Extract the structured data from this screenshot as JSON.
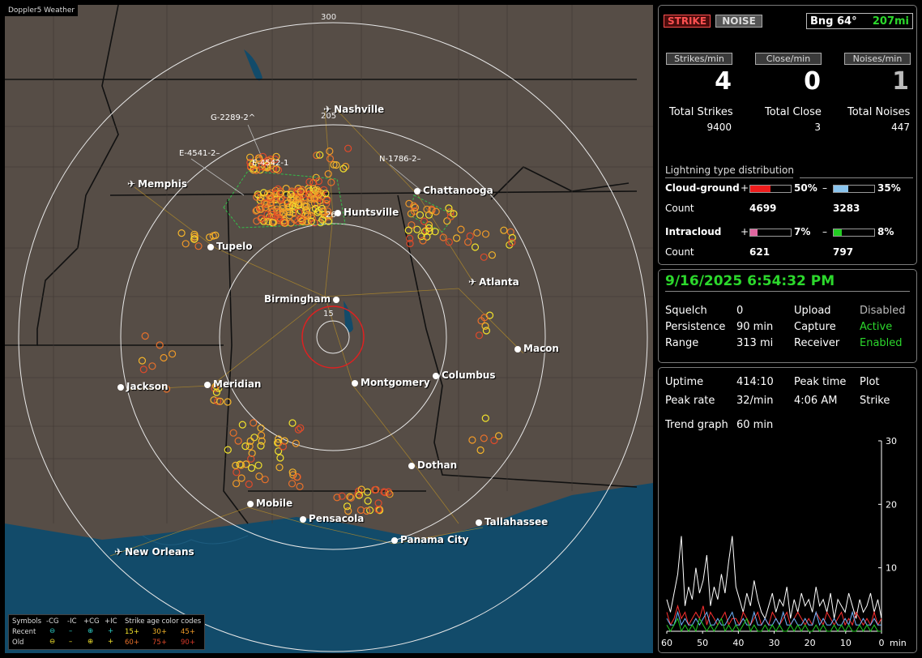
{
  "map": {
    "title": "Doppler5 Weather",
    "ring_labels": [
      "300",
      "205",
      "15"
    ],
    "cities": [
      {
        "name": "Nashville",
        "kind": "airport"
      },
      {
        "name": "Memphis",
        "kind": "airport"
      },
      {
        "name": "Chattanooga",
        "kind": "city"
      },
      {
        "name": "Huntsville",
        "kind": "city"
      },
      {
        "name": "Tupelo",
        "kind": "city"
      },
      {
        "name": "Atlanta",
        "kind": "airport"
      },
      {
        "name": "Birmingham",
        "kind": "city"
      },
      {
        "name": "Macon",
        "kind": "city"
      },
      {
        "name": "Jackson",
        "kind": "city"
      },
      {
        "name": "Meridian",
        "kind": "city"
      },
      {
        "name": "Montgomery",
        "kind": "city"
      },
      {
        "name": "Columbus",
        "kind": "city"
      },
      {
        "name": "Dothan",
        "kind": "city"
      },
      {
        "name": "Mobile",
        "kind": "city"
      },
      {
        "name": "Pensacola",
        "kind": "city"
      },
      {
        "name": "Tallahassee",
        "kind": "city"
      },
      {
        "name": "Panama City",
        "kind": "city"
      },
      {
        "name": "New Orleans",
        "kind": "airport"
      }
    ],
    "storm_tags": [
      "G-2289-2^",
      "E-4541-2–",
      "E-4542-1",
      "N-1786-2–",
      "26"
    ],
    "legend": {
      "symbols_label": "Symbols",
      "headers": [
        "-CG",
        "-IC",
        "+CG",
        "+IC"
      ],
      "age_title": "Strike age color codes",
      "recent_label": "Recent",
      "old_label": "Old",
      "recent_ages": [
        "15+",
        "30+",
        "45+"
      ],
      "old_ages": [
        "60+",
        "75+",
        "90+"
      ],
      "symbol_glyphs": {
        "neg_cg": "⊖",
        "neg_ic": "–",
        "pos_cg": "⊕",
        "pos_ic": "+"
      }
    }
  },
  "status": {
    "strike_label": "STRIKE",
    "noise_label": "NOISE",
    "bearing_label": "Bng 64°",
    "distance": "207mi",
    "rates": [
      {
        "label": "Strikes/min",
        "value": "4"
      },
      {
        "label": "Close/min",
        "value": "0"
      },
      {
        "label": "Noises/min",
        "value": "1"
      }
    ],
    "totals": [
      {
        "label": "Total Strikes",
        "value": "9400"
      },
      {
        "label": "Total Close",
        "value": "3"
      },
      {
        "label": "Total Noises",
        "value": "447"
      }
    ],
    "distribution_title": "Lightning type distribution",
    "cloud_ground": {
      "label": "Cloud-ground",
      "pos_sign": "+",
      "neg_sign": "–",
      "pos_pct": "50%",
      "neg_pct": "35%",
      "pos_fraction": 0.5,
      "neg_fraction": 0.35,
      "count_label": "Count",
      "pos_count": "4699",
      "neg_count": "3283"
    },
    "intracloud": {
      "label": "Intracloud",
      "pos_sign": "+",
      "neg_sign": "–",
      "pos_pct": "7%",
      "neg_pct": "8%",
      "pos_fraction": 0.07,
      "neg_fraction": 0.08,
      "count_label": "Count",
      "pos_count": "621",
      "neg_count": "797"
    }
  },
  "settings": {
    "datetime": "9/16/2025 6:54:32 PM",
    "rows": [
      [
        "Squelch",
        "0",
        "Upload",
        "Disabled"
      ],
      [
        "Persistence",
        "90 min",
        "Capture",
        "Active"
      ],
      [
        "Range",
        "313 mi",
        "Receiver",
        "Enabled"
      ]
    ]
  },
  "stats": {
    "uptime_label": "Uptime",
    "uptime": "414:10",
    "peak_time_label": "Peak time",
    "peak_time": "4:06 AM",
    "plot_label": "Plot",
    "plot": "Strike",
    "peak_rate_label": "Peak rate",
    "peak_rate": "32/min",
    "trend_label": "Trend graph",
    "trend": "60 min"
  },
  "chart_data": {
    "type": "line",
    "title": "",
    "xlabel": "min",
    "ylabel": "",
    "xlim": [
      60,
      0
    ],
    "ylim": [
      0,
      30
    ],
    "x_ticks": [
      "60",
      "50",
      "40",
      "30",
      "20",
      "10",
      "0"
    ],
    "y_ticks": [
      "10",
      "20",
      "30"
    ],
    "series": [
      {
        "color": "#ffffff",
        "values": [
          5,
          3,
          6,
          9,
          15,
          4,
          7,
          5,
          10,
          6,
          8,
          12,
          4,
          7,
          5,
          9,
          6,
          11,
          15,
          7,
          5,
          3,
          6,
          4,
          8,
          5,
          3,
          2,
          4,
          6,
          3,
          5,
          4,
          7,
          2,
          5,
          3,
          6,
          4,
          5,
          3,
          7,
          4,
          5,
          3,
          6,
          2,
          5,
          4,
          3,
          6,
          4,
          2,
          5,
          3,
          4,
          6,
          3,
          5,
          2
        ]
      },
      {
        "color": "#ff3030",
        "values": [
          3,
          1,
          2,
          4,
          2,
          3,
          1,
          2,
          3,
          2,
          4,
          1,
          3,
          2,
          1,
          2,
          3,
          1,
          2,
          2,
          1,
          3,
          2,
          1,
          2,
          3,
          1,
          2,
          1,
          3,
          2,
          1,
          2,
          3,
          1,
          2,
          3,
          2,
          1,
          2,
          1,
          3,
          2,
          1,
          3,
          2,
          1,
          2,
          3,
          1,
          2,
          1,
          3,
          2,
          1,
          2,
          1,
          3,
          1,
          2
        ]
      },
      {
        "color": "#6fb6ff",
        "values": [
          2,
          1,
          1,
          3,
          1,
          2,
          1,
          1,
          2,
          1,
          2,
          3,
          1,
          1,
          2,
          1,
          1,
          2,
          3,
          1,
          1,
          2,
          1,
          1,
          3,
          1,
          1,
          2,
          1,
          1,
          2,
          1,
          3,
          1,
          1,
          2,
          1,
          1,
          2,
          1,
          1,
          3,
          1,
          2,
          1,
          1,
          2,
          1,
          1,
          2,
          1,
          3,
          1,
          1,
          2,
          1,
          1,
          2,
          1,
          1
        ]
      },
      {
        "color": "#22cc22",
        "values": [
          1,
          0,
          1,
          2,
          0,
          1,
          0,
          1,
          0,
          2,
          1,
          0,
          1,
          0,
          1,
          2,
          0,
          1,
          0,
          1,
          0,
          1,
          2,
          0,
          1,
          0,
          0,
          1,
          0,
          1,
          0,
          1,
          0,
          0,
          1,
          0,
          1,
          0,
          1,
          0,
          0,
          1,
          0,
          1,
          0,
          0,
          1,
          0,
          1,
          0,
          1,
          0,
          0,
          1,
          0,
          1,
          0,
          1,
          0,
          0
        ]
      }
    ]
  }
}
